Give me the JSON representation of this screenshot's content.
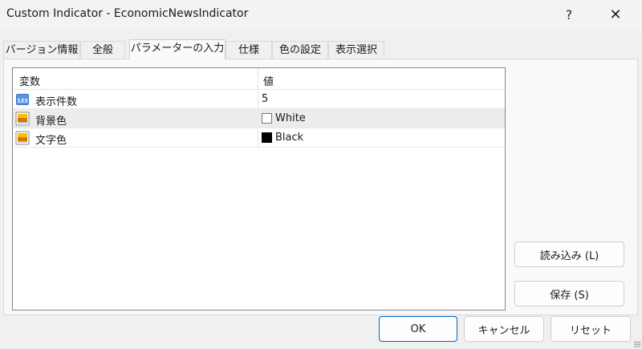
{
  "window": {
    "title": "Custom Indicator - EconomicNewsIndicator",
    "help_label": "?",
    "close_label": "✕"
  },
  "tabs": [
    {
      "label": "バージョン情報"
    },
    {
      "label": "全般"
    },
    {
      "label": "パラメーターの入力"
    },
    {
      "label": "仕様"
    },
    {
      "label": "色の設定"
    },
    {
      "label": "表示選択"
    }
  ],
  "grid": {
    "headers": {
      "variable": "変数",
      "value": "値"
    },
    "rows": [
      {
        "name": "表示件数",
        "value": "5",
        "icon": "numeric-icon"
      },
      {
        "name": "背景色",
        "value": "White",
        "icon": "color-param-icon",
        "swatch": "#ffffff"
      },
      {
        "name": "文字色",
        "value": "Black",
        "icon": "color-param-icon",
        "swatch": "#000000"
      }
    ]
  },
  "side_buttons": {
    "load_label": "読み込み (L)",
    "save_label": "保存 (S)"
  },
  "footer_buttons": {
    "ok_label": "OK",
    "cancel_label": "キャンセル",
    "reset_label": "リセット"
  },
  "colors": {
    "accent": "#0067c0",
    "selected_row": "#ececec"
  }
}
